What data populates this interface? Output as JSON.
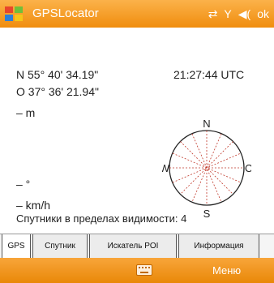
{
  "titlebar": {
    "app_title": "GPSLocator",
    "status_glyphs": {
      "sync": "⇄",
      "signal": "Y",
      "volume": "◀(",
      "ok": "ok"
    }
  },
  "readout": {
    "latitude": "N 55° 40' 34.19\"",
    "longitude": "O 37° 36' 21.94\"",
    "time": "21:27:44 UTC",
    "altitude": "– m",
    "heading": "– °",
    "speed": "– km/h"
  },
  "compass": {
    "north": "N",
    "south": "S",
    "east": "O",
    "west": "W"
  },
  "satellites": {
    "label": "Спутники в пределах видимости:",
    "count": "4"
  },
  "tabs": [
    "GPS",
    "Спутник",
    "Искатель POI",
    "Информация"
  ],
  "menu": {
    "label": "Меню"
  },
  "icons": {
    "start": "windows-flag-icon",
    "keyboard": "keyboard-icon"
  },
  "colors": {
    "titlebar": "#f39a20",
    "menubar": "#f0951a",
    "text": "#222222"
  }
}
